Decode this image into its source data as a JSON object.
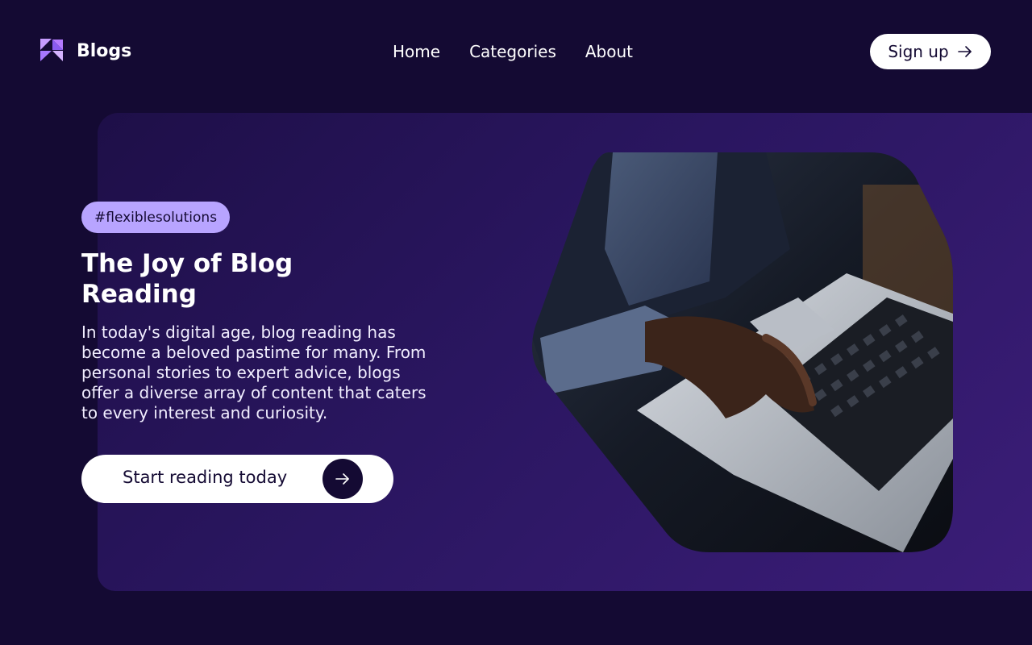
{
  "header": {
    "logo_text": "Blogs",
    "nav": [
      {
        "label": "Home"
      },
      {
        "label": "Categories"
      },
      {
        "label": "About"
      }
    ],
    "signup_label": "Sign up"
  },
  "hero": {
    "tag": "#flexiblesolutions",
    "title": "The Joy of Blog Reading",
    "description": "In today's digital age, blog reading has become a beloved pastime for many. From personal stories to expert advice, blogs offer a diverse array of content that caters to every interest and curiosity.",
    "cta_label": "Start reading today",
    "image_alt": "Person typing on a laptop"
  },
  "colors": {
    "background": "#140a33",
    "panel": "#2a1660",
    "accent": "#b8a4ff",
    "button": "#ffffff"
  },
  "icons": {
    "logo": "logo-mark-icon",
    "signup_arrow": "arrow-right-icon",
    "cta_arrow": "arrow-right-icon"
  }
}
